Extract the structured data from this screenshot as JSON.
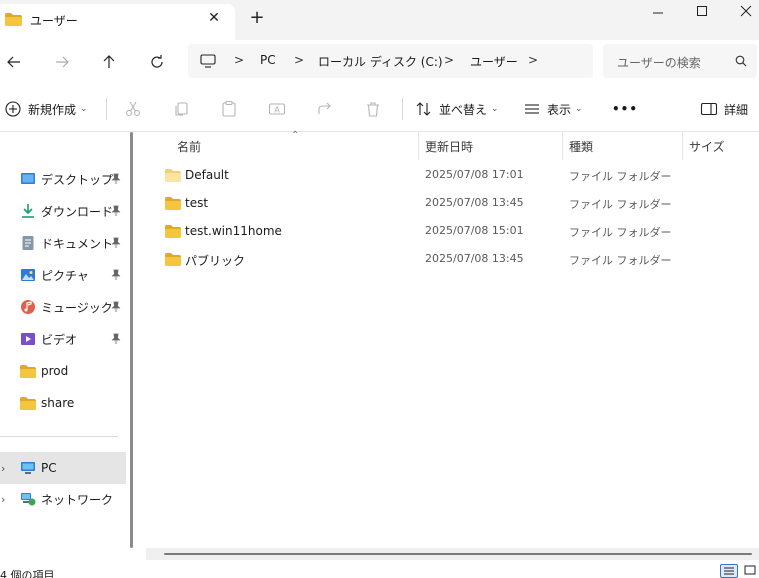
{
  "window": {
    "tab_title": "ユーザー",
    "new_tab_symbol": "+",
    "close_symbol": "✕"
  },
  "address_bar": {
    "breadcrumbs": [
      "PC",
      "ローカル ディスク (C:)",
      "ユーザー"
    ],
    "separator": ">",
    "search_placeholder": "ユーザーの検索"
  },
  "toolbar": {
    "new_label": "新規作成",
    "sort_label": "並べ替え",
    "view_label": "表示",
    "more_label": "•••",
    "details_label": "詳細"
  },
  "sidebar": {
    "quick_access": [
      {
        "label": "デスクトップ",
        "icon": "desktop-icon",
        "pinned": true
      },
      {
        "label": "ダウンロード",
        "icon": "download-icon",
        "pinned": true
      },
      {
        "label": "ドキュメント",
        "icon": "documents-icon",
        "pinned": true
      },
      {
        "label": "ピクチャ",
        "icon": "pictures-icon",
        "pinned": true
      },
      {
        "label": "ミュージック",
        "icon": "music-icon",
        "pinned": true
      },
      {
        "label": "ビデオ",
        "icon": "videos-icon",
        "pinned": true
      },
      {
        "label": "prod",
        "icon": "folder-icon",
        "pinned": false
      },
      {
        "label": "share",
        "icon": "folder-icon",
        "pinned": false
      }
    ],
    "pc_label": "PC",
    "network_label": "ネットワーク"
  },
  "columns": {
    "name": "名前",
    "date": "更新日時",
    "type": "種類",
    "size": "サイズ"
  },
  "files": [
    {
      "name": "Default",
      "date": "2025/07/08 17:01",
      "type": "ファイル フォルダー",
      "icon": "folder-light-icon"
    },
    {
      "name": "test",
      "date": "2025/07/08 13:45",
      "type": "ファイル フォルダー",
      "icon": "folder-icon"
    },
    {
      "name": "test.win11home",
      "date": "2025/07/08 15:01",
      "type": "ファイル フォルダー",
      "icon": "folder-icon"
    },
    {
      "name": "パブリック",
      "date": "2025/07/08 13:45",
      "type": "ファイル フォルダー",
      "icon": "folder-icon"
    }
  ],
  "status": {
    "item_count": "4 個の項目"
  },
  "colors": {
    "folder": "#f4c63d",
    "folder_dark": "#e0a82a",
    "accent": "#3b74c4"
  }
}
